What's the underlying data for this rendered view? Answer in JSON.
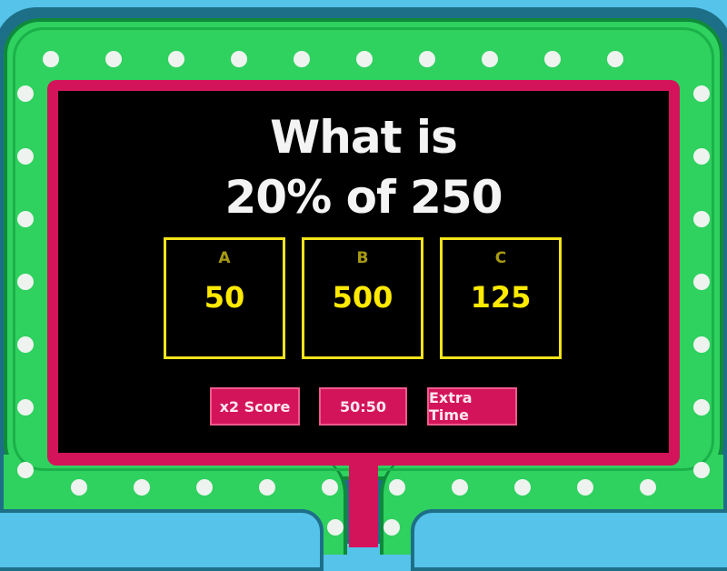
{
  "question": {
    "line1": "What is",
    "line2": "20% of 250"
  },
  "answers": [
    {
      "letter": "A",
      "value": "50"
    },
    {
      "letter": "B",
      "value": "500"
    },
    {
      "letter": "C",
      "value": "125"
    }
  ],
  "powerups": [
    {
      "label": "x2 Score"
    },
    {
      "label": "50:50"
    },
    {
      "label": "Extra Time"
    }
  ],
  "colors": {
    "frame_green": "#2fd15f",
    "screen_pink": "#d4145a",
    "answer_yellow": "#ffea00",
    "background_blue": "#56c3ea"
  }
}
